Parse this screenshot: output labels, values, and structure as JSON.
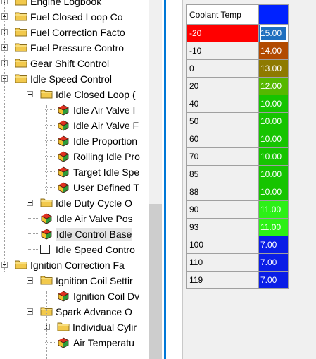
{
  "tree": {
    "rows": [
      {
        "name": "tree-item-engine-logbook",
        "label": "Engine Logbook",
        "type": "folder",
        "depth": 0,
        "expander": "plus"
      },
      {
        "name": "tree-item-fuel-closed-loop",
        "label": "Fuel Closed Loop Co",
        "type": "folder",
        "depth": 0,
        "expander": "plus"
      },
      {
        "name": "tree-item-fuel-correction",
        "label": "Fuel Correction Facto",
        "type": "folder",
        "depth": 0,
        "expander": "plus"
      },
      {
        "name": "tree-item-fuel-pressure",
        "label": "Fuel Pressure Contro",
        "type": "folder",
        "depth": 0,
        "expander": "plus"
      },
      {
        "name": "tree-item-gear-shift",
        "label": "Gear Shift Control",
        "type": "folder",
        "depth": 0,
        "expander": "plus"
      },
      {
        "name": "tree-item-idle-speed-control",
        "label": "Idle Speed Control",
        "type": "folder",
        "depth": 0,
        "expander": "minus"
      },
      {
        "name": "tree-item-idle-closed-loop",
        "label": "Idle Closed Loop (",
        "type": "folder",
        "depth": 1,
        "expander": "minus"
      },
      {
        "name": "tree-item-idle-air-valve-1",
        "label": "Idle Air Valve I",
        "type": "gem",
        "depth": 2,
        "expander": "none"
      },
      {
        "name": "tree-item-idle-air-valve-2",
        "label": "Idle Air Valve F",
        "type": "gem",
        "depth": 2,
        "expander": "none"
      },
      {
        "name": "tree-item-idle-proportion",
        "label": "Idle Proportion",
        "type": "gem",
        "depth": 2,
        "expander": "none"
      },
      {
        "name": "tree-item-rolling-idle",
        "label": "Rolling Idle Pro",
        "type": "gem",
        "depth": 2,
        "expander": "none"
      },
      {
        "name": "tree-item-target-idle",
        "label": "Target Idle Spe",
        "type": "gem",
        "depth": 2,
        "expander": "none"
      },
      {
        "name": "tree-item-user-defined",
        "label": "User Defined T",
        "type": "gem",
        "depth": 2,
        "expander": "none"
      },
      {
        "name": "tree-item-idle-duty-cycle",
        "label": "Idle Duty Cycle O",
        "type": "folder",
        "depth": 1,
        "expander": "plus"
      },
      {
        "name": "tree-item-idle-air-valve-pos",
        "label": "Idle Air Valve Pos",
        "type": "gem",
        "depth": 1,
        "expander": "none"
      },
      {
        "name": "tree-item-idle-control-base",
        "label": "Idle Control Base",
        "type": "gem",
        "depth": 1,
        "expander": "none",
        "selected": true
      },
      {
        "name": "tree-item-idle-speed-contro",
        "label": "Idle Speed Contro",
        "type": "grid",
        "depth": 1,
        "expander": "none"
      },
      {
        "name": "tree-item-ignition-correction",
        "label": "Ignition Correction Fa",
        "type": "folder",
        "depth": 0,
        "expander": "minus"
      },
      {
        "name": "tree-item-ignition-coil-settings",
        "label": "Ignition Coil Settir",
        "type": "folder",
        "depth": 1,
        "expander": "minus"
      },
      {
        "name": "tree-item-ignition-coil-dwell",
        "label": "Ignition Coil Dv",
        "type": "gem",
        "depth": 2,
        "expander": "none"
      },
      {
        "name": "tree-item-spark-advance",
        "label": "Spark Advance O",
        "type": "folder",
        "depth": 1,
        "expander": "minus"
      },
      {
        "name": "tree-item-individual-cylinder",
        "label": "Individual Cylir",
        "type": "folder",
        "depth": 2,
        "expander": "plus"
      },
      {
        "name": "tree-item-air-temperature",
        "label": "Air Temperatu",
        "type": "gem",
        "depth": 2,
        "expander": "none"
      }
    ]
  },
  "table": {
    "header_label": "Coolant Temp",
    "header_color": "#0022ff",
    "rows": [
      {
        "key": "-20",
        "value": "15.00",
        "key_bg": "#ff0000",
        "key_color": "#ffffff",
        "value_bg": "#1f6fbf",
        "selected": true
      },
      {
        "key": "-10",
        "value": "14.00",
        "key_bg": "#f0f0f0",
        "key_color": "#000000",
        "value_bg": "#b24a00"
      },
      {
        "key": "0",
        "value": "13.00",
        "key_bg": "#f0f0f0",
        "key_color": "#000000",
        "value_bg": "#8e7a00"
      },
      {
        "key": "20",
        "value": "12.00",
        "key_bg": "#f0f0f0",
        "key_color": "#000000",
        "value_bg": "#55b800"
      },
      {
        "key": "40",
        "value": "10.00",
        "key_bg": "#f0f0f0",
        "key_color": "#000000",
        "value_bg": "#16c400"
      },
      {
        "key": "50",
        "value": "10.00",
        "key_bg": "#f0f0f0",
        "key_color": "#000000",
        "value_bg": "#16c400"
      },
      {
        "key": "60",
        "value": "10.00",
        "key_bg": "#f0f0f0",
        "key_color": "#000000",
        "value_bg": "#16c400"
      },
      {
        "key": "70",
        "value": "10.00",
        "key_bg": "#f0f0f0",
        "key_color": "#000000",
        "value_bg": "#16c400"
      },
      {
        "key": "85",
        "value": "10.00",
        "key_bg": "#f0f0f0",
        "key_color": "#000000",
        "value_bg": "#16c400"
      },
      {
        "key": "88",
        "value": "10.00",
        "key_bg": "#f0f0f0",
        "key_color": "#000000",
        "value_bg": "#16c400"
      },
      {
        "key": "90",
        "value": "11.00",
        "key_bg": "#f0f0f0",
        "key_color": "#000000",
        "value_bg": "#2cf016"
      },
      {
        "key": "93",
        "value": "11.00",
        "key_bg": "#f0f0f0",
        "key_color": "#000000",
        "value_bg": "#2cf016"
      },
      {
        "key": "100",
        "value": "7.00",
        "key_bg": "#f0f0f0",
        "key_color": "#000000",
        "value_bg": "#0a1ee6"
      },
      {
        "key": "110",
        "value": "7.00",
        "key_bg": "#f0f0f0",
        "key_color": "#000000",
        "value_bg": "#0a1ee6"
      },
      {
        "key": "119",
        "value": "7.00",
        "key_bg": "#f0f0f0",
        "key_color": "#000000",
        "value_bg": "#0a1ee6"
      }
    ]
  },
  "colors": {
    "selection_bg": "#e5e5e5",
    "pane_border": "#0078d7",
    "folder": "#f2c94c"
  }
}
